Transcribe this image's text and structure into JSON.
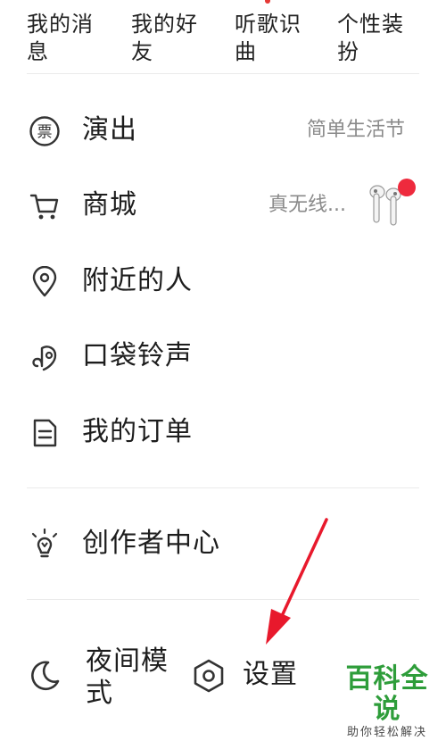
{
  "top_tabs": [
    {
      "label": "我的消息"
    },
    {
      "label": "我的好友"
    },
    {
      "label": "听歌识曲"
    },
    {
      "label": "个性装扮"
    }
  ],
  "menu": {
    "items": [
      {
        "label": "演出",
        "right_text": "简单生活节",
        "icon": "ticket-icon"
      },
      {
        "label": "商城",
        "right_text": "真无线...",
        "icon": "shopping-cart-icon"
      },
      {
        "label": "附近的人",
        "right_text": "",
        "icon": "location-pin-icon"
      },
      {
        "label": "口袋铃声",
        "right_text": "",
        "icon": "music-note-icon"
      },
      {
        "label": "我的订单",
        "right_text": "",
        "icon": "document-icon"
      }
    ],
    "creator": {
      "label": "创作者中心",
      "icon": "lightbulb-icon"
    }
  },
  "bottom_bar": {
    "night_mode_label": "夜间模式",
    "settings_label": "设置"
  },
  "watermark": {
    "title": "百科全说",
    "subtitle": "助你轻松解决"
  },
  "colors": {
    "arrow": "#e8192c",
    "badge": "#ee2a3d",
    "watermark": "#2e9d3a"
  }
}
